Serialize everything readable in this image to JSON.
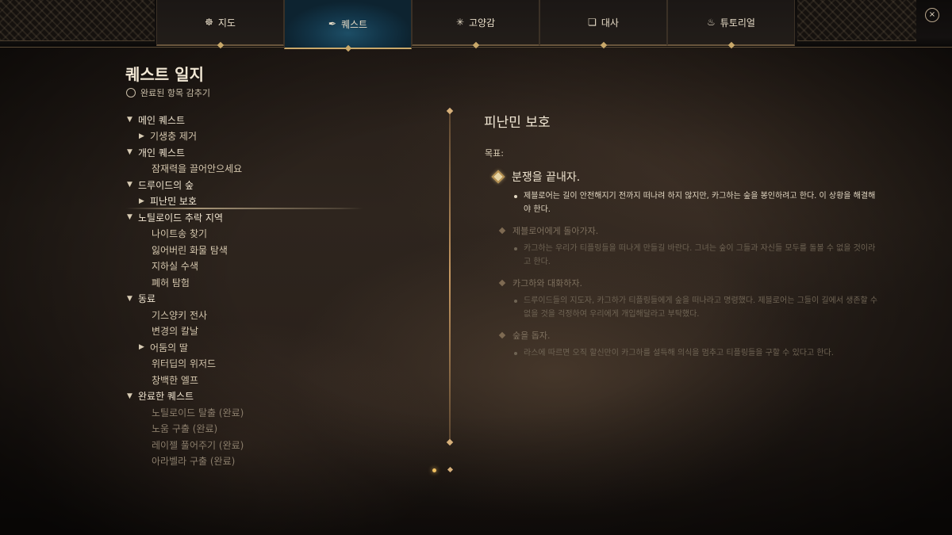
{
  "tabs": [
    {
      "label": "지도",
      "icon": "compass-icon",
      "glyph": "☸"
    },
    {
      "label": "퀘스트",
      "icon": "quill-icon",
      "glyph": "✒"
    },
    {
      "label": "고양감",
      "icon": "spark-icon",
      "glyph": "✳"
    },
    {
      "label": "대사",
      "icon": "scroll-icon",
      "glyph": "❏"
    },
    {
      "label": "튜토리얼",
      "icon": "flame-icon",
      "glyph": "♨"
    }
  ],
  "close_label": "×",
  "journal": {
    "title": "퀘스트 일지",
    "hide_completed": "완료된 항목 감추기"
  },
  "tree": {
    "main_quests": "메인 퀘스트",
    "main_items": [
      "기생충 제거"
    ],
    "personal_quests": "개인 퀘스트",
    "personal_items": [
      "잠재력을 끌어안으세요"
    ],
    "druid_grove": "드루이드의 숲",
    "druid_items": [
      "피난민 보호"
    ],
    "blighted_village": "노틸로이드 추락 지역",
    "blighted_items": [
      "나이트송 찾기",
      "잃어버린 화물 탐색",
      "지하실 수색",
      "폐허 탐험"
    ],
    "companions": "동료",
    "companion_items": [
      "기스양키 전사",
      "변경의 칼날",
      "어둠의 딸",
      "위터딥의 위저드",
      "창백한 엘프"
    ],
    "completed_quests": "완료한 퀘스트",
    "completed_items": [
      "노틸로이드 탈출 (완료)",
      "노움 구출 (완료)",
      "레이젤 풀어주기 (완료)",
      "아라벨라 구출 (완료)"
    ]
  },
  "quest": {
    "title": "피난민 보호",
    "objective_label": "목표:",
    "objectives": [
      {
        "head": "분쟁을 끝내자.",
        "desc": "제블로어는 길이 안전해지기 전까지 떠나려 하지 않지만, 카그하는 숲을 봉인하려고 한다. 이 상황을 해결해야 한다."
      },
      {
        "head": "제블로어에게 돌아가자.",
        "desc": "카그하는 우리가 티플링들을 떠나게 만들길 바란다. 그녀는 숲이 그들과 자신들 모두를 돌볼 수 없을 것이라고 한다."
      },
      {
        "head": "카그하와 대화하자.",
        "desc": "드루이드들의 지도자, 카그하가 티플링들에게 숲을 떠나라고 명령했다. 제블로어는 그들이 길에서 생존할 수 없을 것을 걱정하여 우리에게 개입해달라고 부탁했다."
      },
      {
        "head": "숲을 돕자.",
        "desc": "라스에 따르면 오직 할신만이 카그하를 설득해 의식을 멈추고 티플링들을 구할 수 있다고 한다."
      }
    ]
  }
}
